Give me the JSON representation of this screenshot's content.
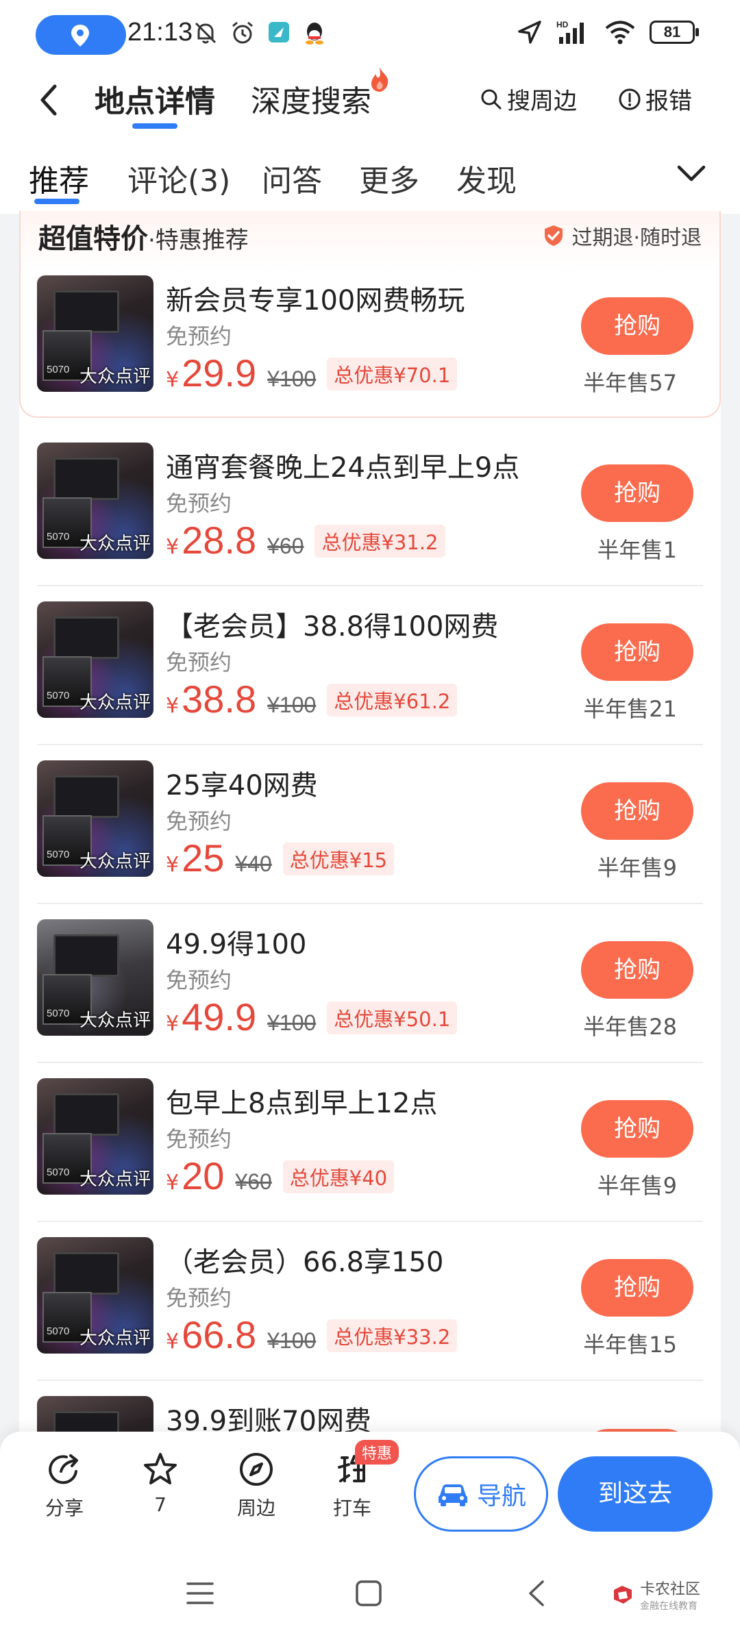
{
  "status_bar": {
    "time": "21:13",
    "battery": "81",
    "icons": [
      "location-icon",
      "mute-icon",
      "alarm-icon",
      "app-icon",
      "qq-icon",
      "nav-arrow-icon",
      "signal-icon",
      "wifi-icon"
    ]
  },
  "header": {
    "tabs": [
      {
        "label": "地点详情",
        "active": true
      },
      {
        "label": "深度搜索",
        "active": false
      }
    ],
    "search_nearby": "搜周边",
    "report_error": "报错"
  },
  "subtabs": {
    "items": [
      "推荐",
      "评论(3)",
      "问答",
      "更多",
      "发现"
    ],
    "active_index": 0
  },
  "special": {
    "title": "超值特价",
    "subtitle": "·特惠推荐",
    "refund_text": "过期退·随时退"
  },
  "watermark_text": "大众点评",
  "items": [
    {
      "title": "新会员专享100网费畅玩",
      "note": "免预约",
      "currency": "¥",
      "price": "29.9",
      "original": "¥100",
      "discount": "总优惠¥70.1",
      "button": "抢购",
      "sold": "半年售57"
    },
    {
      "title": "通宵套餐晚上24点到早上9点",
      "note": "免预约",
      "currency": "¥",
      "price": "28.8",
      "original": "¥60",
      "discount": "总优惠¥31.2",
      "button": "抢购",
      "sold": "半年售1"
    },
    {
      "title": "【老会员】38.8得100网费",
      "note": "免预约",
      "currency": "¥",
      "price": "38.8",
      "original": "¥100",
      "discount": "总优惠¥61.2",
      "button": "抢购",
      "sold": "半年售21"
    },
    {
      "title": "25享40网费",
      "note": "免预约",
      "currency": "¥",
      "price": "25",
      "original": "¥40",
      "discount": "总优惠¥15",
      "button": "抢购",
      "sold": "半年售9"
    },
    {
      "title": "49.9得100",
      "note": "免预约",
      "currency": "¥",
      "price": "49.9",
      "original": "¥100",
      "discount": "总优惠¥50.1",
      "button": "抢购",
      "sold": "半年售28"
    },
    {
      "title": "包早上8点到早上12点",
      "note": "免预约",
      "currency": "¥",
      "price": "20",
      "original": "¥60",
      "discount": "总优惠¥40",
      "button": "抢购",
      "sold": "半年售9"
    },
    {
      "title": "（老会员）66.8享150",
      "note": "免预约",
      "currency": "¥",
      "price": "66.8",
      "original": "¥100",
      "discount": "总优惠¥33.2",
      "button": "抢购",
      "sold": "半年售15"
    },
    {
      "title": "39.9到账70网费"
    }
  ],
  "bottom_bar": {
    "share": "分享",
    "favorite_count": "7",
    "nearby": "周边",
    "taxi": "打车",
    "taxi_badge": "特惠",
    "navigate": "导航",
    "go_here": "到这去"
  },
  "brand_watermark": {
    "name": "卡农社区",
    "tagline": "金融在线教育"
  },
  "colors": {
    "accent_blue": "#2f7cf6",
    "price_red": "#e5483a",
    "buy_orange": "#fb6b4d"
  }
}
